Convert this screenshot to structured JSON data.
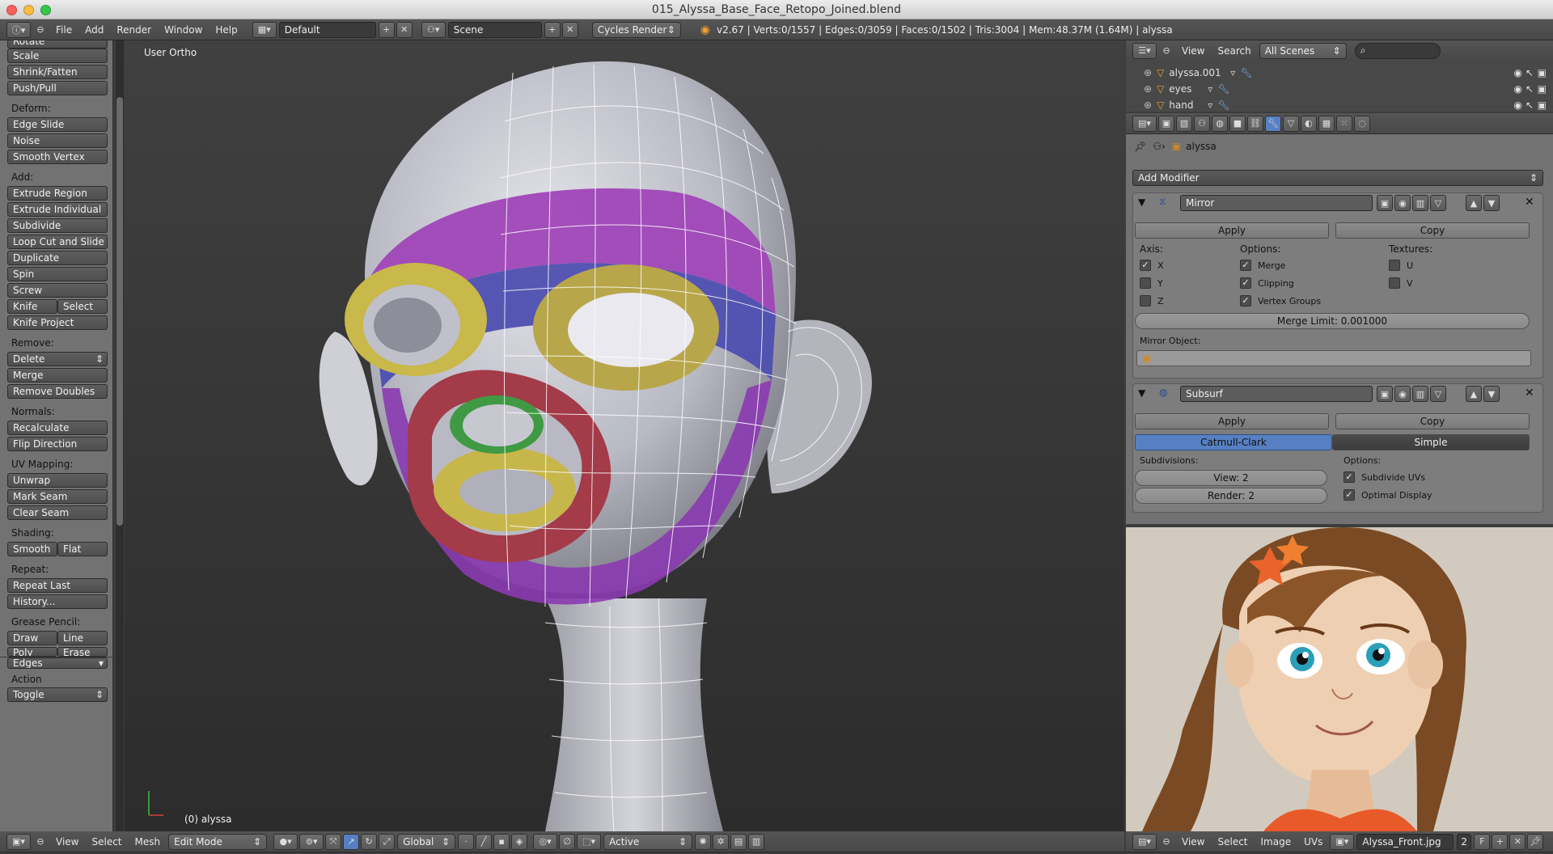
{
  "window": {
    "title": "015_Alyssa_Base_Face_Retopo_Joined.blend"
  },
  "info_header": {
    "menus": [
      "File",
      "Add",
      "Render",
      "Window",
      "Help"
    ],
    "layout": "Default",
    "scene": "Scene",
    "engine": "Cycles Render",
    "stats": "v2.67 | Verts:0/1557 | Edges:0/3059 | Faces:0/1502 | Tris:3004 | Mem:48.37M (1.64M) | alyssa"
  },
  "toolshelf": {
    "top_buttons": [
      "Rotate",
      "Scale",
      "Shrink/Fatten",
      "Push/Pull"
    ],
    "deform_label": "Deform:",
    "deform": [
      "Edge Slide",
      "Noise",
      "Smooth Vertex"
    ],
    "add_label": "Add:",
    "add": [
      "Extrude Region",
      "Extrude Individual",
      "Subdivide",
      "Loop Cut and Slide",
      "Duplicate",
      "Spin",
      "Screw"
    ],
    "knife": "Knife",
    "select": "Select",
    "knife_project": "Knife Project",
    "remove_label": "Remove:",
    "delete": "Delete",
    "merge": "Merge",
    "remove_doubles": "Remove Doubles",
    "normals_label": "Normals:",
    "recalculate": "Recalculate",
    "flip_direction": "Flip Direction",
    "uv_label": "UV Mapping:",
    "unwrap": "Unwrap",
    "mark_seam": "Mark Seam",
    "clear_seam": "Clear Seam",
    "shading_label": "Shading:",
    "smooth": "Smooth",
    "flat": "Flat",
    "repeat_label": "Repeat:",
    "repeat_last": "Repeat Last",
    "history": "History...",
    "grease_label": "Grease Pencil:",
    "draw": "Draw",
    "line": "Line",
    "poly": "Poly",
    "erase": "Erase",
    "edges": "Edges",
    "action_label": "Action",
    "toggle": "Toggle"
  },
  "viewport": {
    "view_name": "User Ortho",
    "object_label": "(0) alyssa"
  },
  "view_header": {
    "menus": [
      "View",
      "Select",
      "Mesh"
    ],
    "mode": "Edit Mode",
    "orientation": "Global",
    "pivot": "Active"
  },
  "outliner": {
    "menus": [
      "View",
      "Search"
    ],
    "scenes": "All Scenes",
    "rows": [
      "alyssa.001",
      "eyes",
      "hand"
    ]
  },
  "properties": {
    "object": "alyssa",
    "add_modifier": "Add Modifier",
    "mirror": {
      "name": "Mirror",
      "apply": "Apply",
      "copy": "Copy",
      "axis_label": "Axis:",
      "options_label": "Options:",
      "textures_label": "Textures:",
      "axis": [
        "X",
        "Y",
        "Z"
      ],
      "options": [
        "Merge",
        "Clipping",
        "Vertex Groups"
      ],
      "textures": [
        "U",
        "V"
      ],
      "merge_limit": "Merge Limit: 0.001000",
      "mirror_object_label": "Mirror Object:"
    },
    "subsurf": {
      "name": "Subsurf",
      "apply": "Apply",
      "copy": "Copy",
      "catmull": "Catmull-Clark",
      "simple": "Simple",
      "subdivisions_label": "Subdivisions:",
      "options_label": "Options:",
      "view": "View: 2",
      "render": "Render: 2",
      "subdivide_uvs": "Subdivide UVs",
      "optimal_display": "Optimal Display"
    }
  },
  "image_header": {
    "menus": [
      "View",
      "Select",
      "Image",
      "UVs"
    ],
    "image_name": "Alyssa_Front.jpg",
    "users": "2",
    "fake": "F"
  },
  "colors": {
    "accent": "#5680c2",
    "viewport_top": "#404040",
    "viewport_bottom": "#2c2c2c",
    "panel": "#727272"
  }
}
